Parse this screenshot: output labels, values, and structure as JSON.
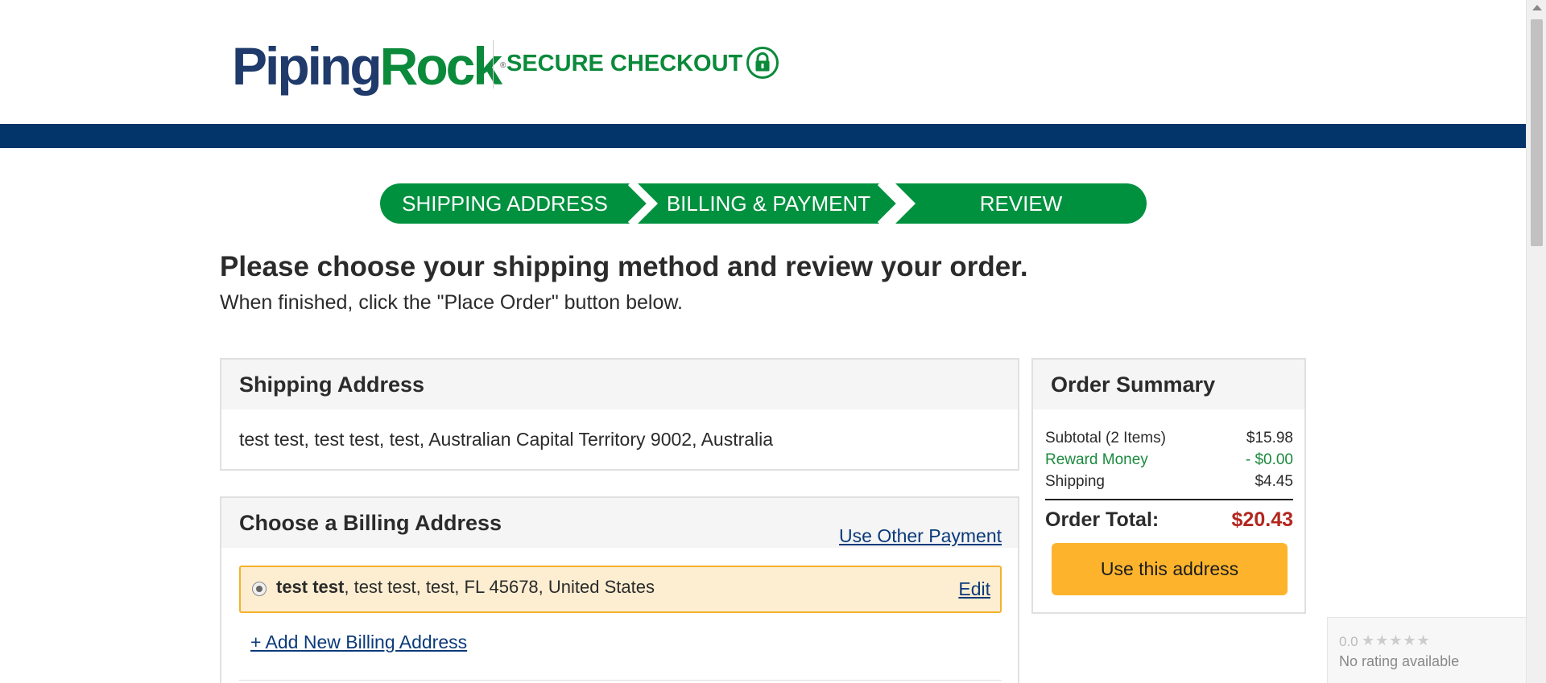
{
  "header": {
    "logo_part1": "Piping",
    "logo_part2": "Rock",
    "logo_reg": "®",
    "secure_label": "SECURE CHECKOUT"
  },
  "steps": [
    {
      "label": "SHIPPING ADDRESS"
    },
    {
      "label": "BILLING & PAYMENT"
    },
    {
      "label": "REVIEW"
    }
  ],
  "heading": {
    "title": "Please choose your shipping method and review your order.",
    "subtitle": "When finished, click the \"Place Order\" button below."
  },
  "shipping": {
    "title": "Shipping Address",
    "address": "test test, test test, test, Australian Capital Territory 9002, Australia"
  },
  "billing": {
    "title": "Choose a Billing Address",
    "use_other_payment": "Use Other Payment",
    "selected_name": "test test",
    "selected_address": ", test test, test, FL 45678, United States",
    "edit_label": "Edit",
    "add_new_label": "+ Add New Billing Address"
  },
  "summary": {
    "title": "Order Summary",
    "subtotal_label": "Subtotal (2 Items)",
    "subtotal_value": "$15.98",
    "reward_label": "Reward Money",
    "reward_value": "- $0.00",
    "shipping_label": "Shipping",
    "shipping_value": "$4.45",
    "total_label": "Order Total:",
    "total_value": "$20.43",
    "button_label": "Use this address"
  },
  "rating": {
    "score": "0.0",
    "stars": "★★★★★",
    "text": "No rating available"
  },
  "colors": {
    "navy": "#03356a",
    "green": "#00913f",
    "accent_orange": "#fdb42c",
    "total_red": "#b3261e"
  }
}
